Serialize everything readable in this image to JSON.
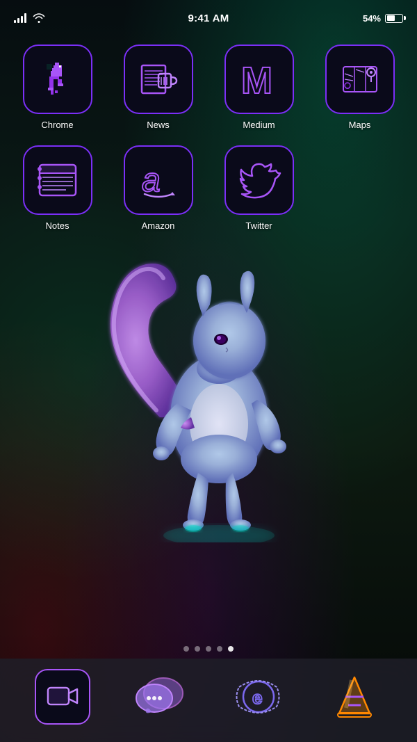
{
  "statusBar": {
    "time": "9:41 AM",
    "battery": "54%",
    "signal": "full",
    "wifi": true
  },
  "apps": [
    {
      "id": "chrome",
      "label": "Chrome",
      "row": 1
    },
    {
      "id": "news",
      "label": "News",
      "row": 1
    },
    {
      "id": "medium",
      "label": "Medium",
      "row": 1
    },
    {
      "id": "maps",
      "label": "Maps",
      "row": 1
    },
    {
      "id": "notes",
      "label": "Notes",
      "row": 2
    },
    {
      "id": "amazon",
      "label": "Amazon",
      "row": 2
    },
    {
      "id": "twitter",
      "label": "Twitter",
      "row": 2
    }
  ],
  "dock": [
    {
      "id": "facetime",
      "label": "FaceTime"
    },
    {
      "id": "messages",
      "label": "Messages"
    },
    {
      "id": "explorer",
      "label": "Internet Explorer"
    },
    {
      "id": "vlc",
      "label": "VLC"
    }
  ],
  "pageDots": {
    "total": 5,
    "active": 4
  },
  "colors": {
    "accent": "#a855f7",
    "border": "#7b2ff7",
    "iconBg": "#0a0a1a"
  }
}
